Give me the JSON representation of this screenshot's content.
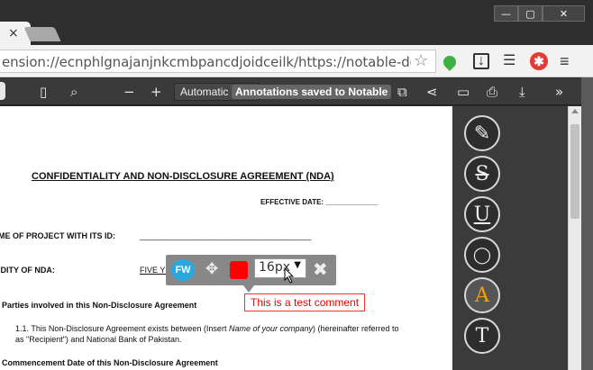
{
  "window": {
    "tab_close": "×",
    "controls": {
      "minimize": "—",
      "maximize": "▢",
      "close": "✕"
    }
  },
  "address_bar": {
    "url": "ension://ecnphlgnajanjnkcmbpancdjoidceilk/https://notable-docs-pro",
    "star_icon": "star-icon",
    "extensions": [
      "green-leaf-extension-icon",
      "download-extension-icon",
      "list-extension-icon",
      "red-star-extension-icon",
      "menu-icon"
    ]
  },
  "pdf_toolbar": {
    "zoom_label": "Automatic Zoom",
    "toast": "Annotations saved to Notable",
    "minus": "−",
    "plus": "+"
  },
  "document": {
    "title": "CONFIDENTIALITY AND NON-DISCLOSURE AGREEMENT (NDA)",
    "effective_date": "EFFECTIVE DATE: _____________",
    "project_label": "ME OF PROJECT WITH ITS ID:",
    "project_line": "______________________________________",
    "validity_label": "IDITY OF NDA:",
    "validity_value": "FIVE YEARS FROM THE EFFECTIVE DATE",
    "section1": "Parties involved in this Non-Disclosure Agreement",
    "para_pre": "1.1. This Non-Disclosure Agreement exists between (Insert ",
    "para_italic": "Name of your company",
    "para_post": ") (hereinafter referred to as \"Recipient\") and National Bank of Pakistan.",
    "section2": "Commencement Date of this Non-Disclosure Agreement"
  },
  "annotation_toolbar": {
    "user_initials": "FW",
    "color": "#ff0000",
    "font_size": "16px",
    "comment": "This is a test comment"
  },
  "sidebar_tools": [
    {
      "name": "highlighter-tool",
      "glyph": "✎"
    },
    {
      "name": "strikethrough-tool",
      "glyph": "S"
    },
    {
      "name": "underline-tool",
      "glyph": "U"
    },
    {
      "name": "comment-tool",
      "glyph": "💬"
    },
    {
      "name": "text-color-tool",
      "glyph": "A"
    },
    {
      "name": "text-insert-tool",
      "glyph": "T"
    }
  ]
}
